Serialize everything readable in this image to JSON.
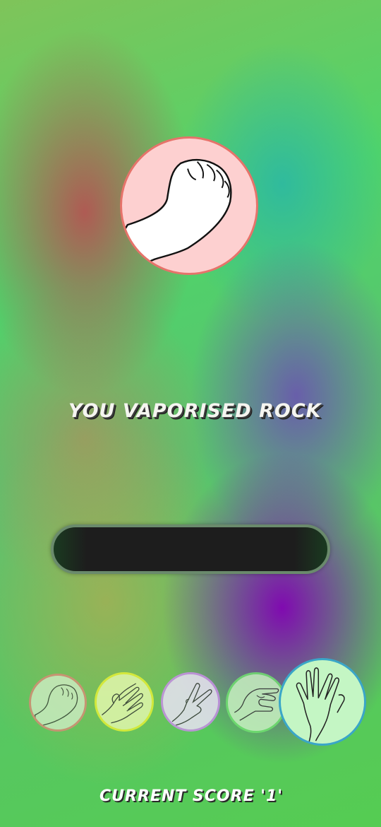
{
  "game": {
    "computer_choice": {
      "name": "rock",
      "icon": "rock-hand-icon",
      "ring_color": "#e6736a",
      "fill_color": "#fdd0d0"
    },
    "result_text": "YOU VAPORISED ROCK",
    "timer": {
      "progress": 0
    },
    "choices": [
      {
        "name": "rock",
        "icon": "rock-hand-icon",
        "ring_color": "#e38679"
      },
      {
        "name": "paper",
        "icon": "paper-hand-icon",
        "ring_color": "#e8f235"
      },
      {
        "name": "scissors",
        "icon": "scissors-hand-icon",
        "ring_color": "#c98ee8"
      },
      {
        "name": "lizard",
        "icon": "lizard-hand-icon",
        "ring_color": "#6fe06f"
      },
      {
        "name": "spock",
        "icon": "spock-hand-icon",
        "ring_color": "#3aa6c8",
        "selected": true
      }
    ],
    "score_label": "CURRENT SCORE",
    "score_value": "'1'"
  }
}
